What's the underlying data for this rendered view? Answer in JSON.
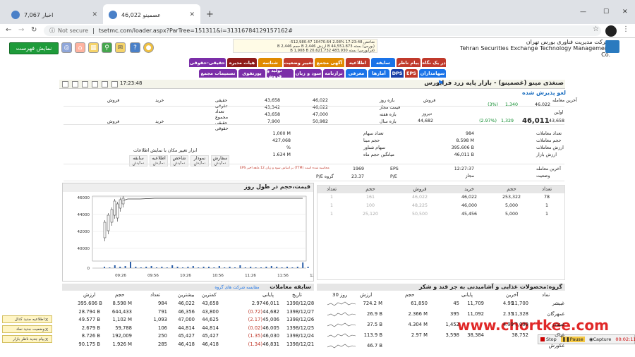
{
  "browser": {
    "tabs": [
      {
        "title": "اخبار 7,067"
      },
      {
        "title": "عصمینو 46,022"
      }
    ],
    "address": {
      "security": "Not secure",
      "url": "tsetmc.com/loader.aspx?ParTree=151311&i=31316784129157162#"
    }
  },
  "header": {
    "show_list": "نمایش فهرست",
    "org_name_fa": "شرکت مدیریت فناوری بورس تهران",
    "org_name_en": "Tehran Securities Exchange Technology Management Co.",
    "ticker_lines": [
      "شاخص 17:23:48 %2.08 10470.64 512,980.47-",
      "(بورس) بسته 44,551.873 B ارزش 2,446 B حجم 2,446 B",
      "(فرابورس) بسته 483,930 B 1,908 B 20,621.732"
    ]
  },
  "menu": {
    "row1": [
      {
        "label": "در یک نگاه",
        "color": "#c0392b"
      },
      {
        "label": "پیام ناظر",
        "color": "#c0392b"
      },
      {
        "label": "سابقه",
        "color": "#1a73e8"
      },
      {
        "label": "اطلاعیه",
        "color": "#c0392b"
      },
      {
        "label": "آگهی مجمع",
        "color": "#e08a00"
      },
      {
        "label": "تغییر وضعیت",
        "color": "#c0392b"
      },
      {
        "label": "شناسه",
        "color": "#e08a00"
      },
      {
        "label": "هیات مدیره",
        "color": "#8e1a1a"
      },
      {
        "label": "حقیقی-حقوقی",
        "color": "#7b2ea8"
      }
    ],
    "row2": [
      {
        "label": "سهامداران",
        "color": "#1a73e8"
      },
      {
        "label": "EPS",
        "color": "#c0392b"
      },
      {
        "label": "DPS",
        "color": "#1a3fa8"
      },
      {
        "label": "آمارها",
        "color": "#1a73e8"
      },
      {
        "label": "معرفی",
        "color": "#1a73e8"
      },
      {
        "label": "ترازنامه",
        "color": "#7b2ea8"
      },
      {
        "label": "سود و زیان",
        "color": "#7b2ea8"
      },
      {
        "label": "تولید و فروش",
        "color": "#7b2ea8"
      },
      {
        "label": "پورتفوی",
        "color": "#7b2ea8"
      },
      {
        "label": "تصمیمات مجمع",
        "color": "#7b2ea8"
      }
    ]
  },
  "symbol": {
    "title": "صنغذی مینو (غصمینو) - بازار پایه زرد فرابورس",
    "time": "17:23:48",
    "status": "لغو پذیرش شده"
  },
  "prices": {
    "rows": [
      {
        "label": "آخرین معامله",
        "val": "46,022",
        "chg": "1,340",
        "pct": "(3%)"
      },
      {
        "label": "قیمت پایانی",
        "val": "46,011",
        "chg": "1,329",
        "pct": "(2.97%)"
      },
      {
        "label": "اولین",
        "val": "43,658"
      },
      {
        "label": "دیروز",
        "val": "44,682"
      }
    ],
    "ranges": [
      {
        "label": "بازه روز",
        "a": "46,022",
        "b": "43,658"
      },
      {
        "label": "قیمت مجاز",
        "a": "46,022",
        "b": "43,342"
      },
      {
        "label": "بازه هفته",
        "a": "47,000",
        "b": "43,658"
      },
      {
        "label": "بازه سال",
        "a": "50,982",
        "b": "7,900"
      }
    ],
    "info": [
      {
        "label": "تعداد معاملات",
        "v": "984"
      },
      {
        "label": "حجم معاملات",
        "v": "8.598 M"
      },
      {
        "label": "ارزش معاملات",
        "v": "395.606 B"
      },
      {
        "label": "ارزش بازار",
        "v": "46,011 B"
      },
      {
        "label": "آخرین معامله",
        "v": "12:27:37"
      },
      {
        "label": "وضعیت",
        "v": "مجاز"
      }
    ],
    "info2": [
      {
        "label": "تعداد سهام",
        "v": "984"
      },
      {
        "label": "حجم مبنا",
        "v": "8.598 M"
      },
      {
        "label": "سهام شناور",
        "v": "395.606 B"
      },
      {
        "label": "میانگین حجم ماه",
        "v": "46,011 B"
      }
    ],
    "info3": [
      {
        "label": "",
        "v": "1,000 M"
      },
      {
        "label": "",
        "v": "427,068"
      },
      {
        "label": "",
        "v": "%"
      },
      {
        "label": "",
        "v": "1.634 M"
      }
    ],
    "eps": {
      "eps_label": "EPS",
      "eps": "1969",
      "pe_label": "P/E",
      "pe": "23.37",
      "gpe_label": "P/E گروه"
    },
    "buysell": {
      "buy": "خرید",
      "sell": "فروش",
      "items": [
        "حقیقی",
        "حقوقی",
        "تعداد",
        "مجموع",
        "حقیقی",
        "حقوقی"
      ]
    },
    "tools": [
      "سفارش نمایش",
      "نمودار نمایش",
      "شاخص نمایش",
      "اطلاعیه نمایش",
      "سابقه نمایش"
    ],
    "tools_title": "ابزار تغییر مکان با نمایش اطلاعات",
    "note": "EPS بر اساس سود و زیان 12 ماهه اخیر (TTM) محاسبه شده است"
  },
  "chart": {
    "title": "قیمت،حجم در طول روز",
    "x_ticks": [
      "09:26",
      "09:56",
      "10:26",
      "10:56",
      "11:26",
      "11:56",
      "12:26"
    ],
    "y_ticks": [
      "46000",
      "44000",
      "42000",
      "40000",
      "0"
    ]
  },
  "chart_data": {
    "type": "table",
    "title": "قیمت،حجم در طول روز"
  },
  "orderbook": {
    "headers": [
      "تعداد",
      "حجم",
      "خرید",
      "فروش",
      "حجم",
      "تعداد"
    ],
    "rows": [
      [
        "78",
        "253,322",
        "46,022",
        "46,022",
        "161",
        "1"
      ],
      [
        "1",
        "5,000",
        "46,000",
        "48,225",
        "100",
        "1"
      ],
      [
        "1",
        "5,000",
        "45,456",
        "50,500",
        "25,120",
        "1"
      ]
    ]
  },
  "history": {
    "title": "سابقه معاملات",
    "compare": "مقایسه شرکت های گروه",
    "headers": [
      "تاریخ",
      "پایانی",
      "",
      "کمترین",
      "بیشترین",
      "تعداد",
      "حجم",
      "ارزش"
    ],
    "rows": [
      [
        "1398/12/28",
        "46,011",
        "2.97",
        "43,658",
        "46,022",
        "984",
        "8.598 M",
        "395.606 B"
      ],
      [
        "1398/12/27",
        "44,682",
        "(0.72)",
        "43,800",
        "46,356",
        "791",
        "644,433",
        "28.794 B"
      ],
      [
        "1398/12/26",
        "45,006",
        "(2.17)",
        "44,625",
        "47,000",
        "1,093",
        "1,102 M",
        "49.577 B"
      ],
      [
        "1398/12/25",
        "46,005",
        "(0.02)",
        "44,814",
        "44,814",
        "106",
        "59,788",
        "2.679 B"
      ],
      [
        "1398/12/24",
        "46,030",
        "(1.35)",
        "45,427",
        "45,427",
        "250",
        "192,009",
        "8.726 B"
      ],
      [
        "1398/12/21",
        "46,831",
        "(1.34)",
        "46,418",
        "46,418",
        "285",
        "1.926 M",
        "90.175 B"
      ]
    ]
  },
  "group": {
    "title": "گروه:محصولات غذایی و آشامیدنی به جز قند و شکر",
    "days": "30 روز",
    "headers": [
      "نماد",
      "آخرین",
      "",
      "پایانی",
      "",
      "حجم",
      "ارزش"
    ],
    "rows": [
      [
        "غبیشر",
        "11,700",
        "4.99",
        "11,709",
        "45",
        "61,850",
        "724.2 M"
      ],
      [
        "غمهرگان",
        "11,328",
        "2.35",
        "11,092",
        "395",
        "2.366 M",
        "26.9 B"
      ],
      [
        "غشاذر",
        "7,099",
        "4.99",
        "",
        "1,452",
        "4.304 M",
        "37.5 B"
      ],
      [
        "غپاک",
        "38,752",
        "",
        "38,384",
        "3,598",
        "2.97 M",
        "113.9 B"
      ],
      [
        "غکورش",
        "",
        "",
        "",
        "",
        "",
        "46.7 B"
      ]
    ]
  },
  "notifications": [
    "اطلاعیه جدید کدال",
    "وضعیت جدید نماد",
    "پیام جدید ناظر بازار"
  ],
  "watermark": "www.chortkee.com",
  "recorder": {
    "stop": "Stop",
    "pause": "Pause",
    "capture": "Capture",
    "time": "00:02:11"
  }
}
